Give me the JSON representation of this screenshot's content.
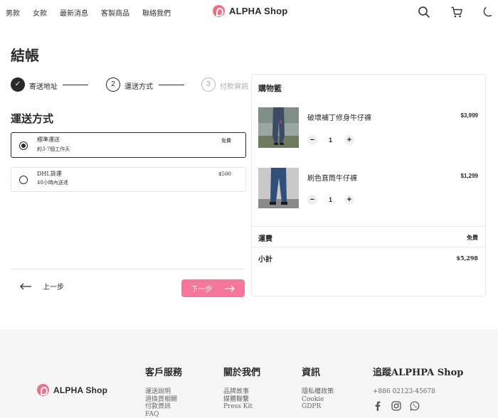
{
  "header": {
    "nav": [
      "男款",
      "女款",
      "最新消息",
      "客製商品",
      "聯絡我們"
    ],
    "brand": "ALPHA Shop",
    "icons": [
      "search-icon",
      "cart-icon",
      "moon-icon"
    ]
  },
  "page": {
    "title": "結帳"
  },
  "stepper": {
    "steps": [
      {
        "number": "✓",
        "label": "寄送地址",
        "state": "done"
      },
      {
        "number": "2",
        "label": "運送方式",
        "state": "active"
      },
      {
        "number": "3",
        "label": "付款資訊",
        "state": "pending"
      }
    ]
  },
  "shipping": {
    "title": "運送方式",
    "options": [
      {
        "name": "標準運送",
        "desc": "約3-7個工作天",
        "price": "免費",
        "selected": true
      },
      {
        "name": "DHL貨運",
        "desc": "48小時內送達",
        "price": "$500",
        "selected": false
      }
    ]
  },
  "buttons": {
    "prev": "上一步",
    "next": "下一步"
  },
  "cart": {
    "title": "購物籃",
    "items": [
      {
        "name": "破壞補丁修身牛仔褲",
        "price": "$3,999",
        "qty": "1"
      },
      {
        "name": "刷色直筒牛仔褲",
        "price": "$1,299",
        "qty": "1"
      }
    ],
    "shipping_label": "運費",
    "shipping_value": "免費",
    "subtotal_label": "小計",
    "subtotal_value": "$5,298"
  },
  "footer": {
    "brand": "ALPHA Shop",
    "columns": [
      {
        "title": "客戶服務",
        "items": [
          "運送說明",
          "退換貨相關",
          "付款資訊",
          "FAQ"
        ]
      },
      {
        "title": "關於我們",
        "items": [
          "品牌故事",
          "媒體聯繫",
          "Press Kit"
        ]
      },
      {
        "title": "資訊",
        "items": [
          "隱私權政策",
          "Cookie",
          "GDPR"
        ]
      },
      {
        "title": "追蹤ALPHPA Shop",
        "items": [
          "+886 02123-45678"
        ]
      }
    ],
    "social": [
      "facebook-icon",
      "instagram-icon",
      "whatsapp-icon"
    ]
  },
  "colors": {
    "accent": "#f67599",
    "logo": "#f06f87",
    "footer_bg": "#f5f5f5"
  }
}
